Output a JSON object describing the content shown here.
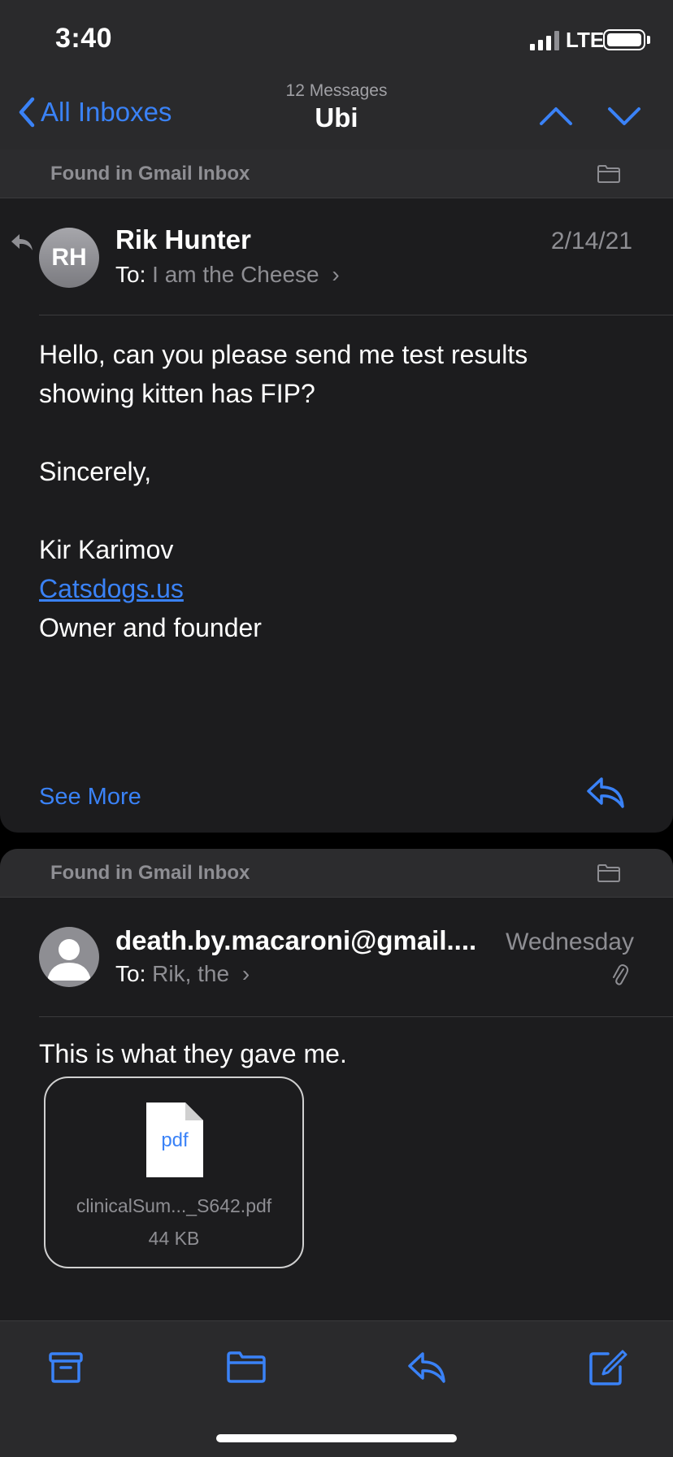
{
  "status_bar": {
    "time": "3:40",
    "network": "LTE"
  },
  "nav": {
    "back_label": "All Inboxes",
    "message_count": "12 Messages",
    "title": "Ubi"
  },
  "messages": [
    {
      "found_in": "Found in Gmail Inbox",
      "avatar_initials": "RH",
      "sender": "Rik Hunter",
      "to_label": "To:",
      "to_names": "I am the Cheese",
      "date": "2/14/21",
      "body": {
        "line1": "Hello, can you please send me test results",
        "line2": "showing kitten has FIP?",
        "closing": "Sincerely,",
        "signature_name": "Kir Karimov",
        "signature_link": "Catsdogs.us",
        "signature_title": "Owner and founder"
      },
      "see_more": "See More"
    },
    {
      "found_in": "Found in Gmail Inbox",
      "sender": "death.by.macaroni@gmail....",
      "to_label": "To:",
      "to_names": "Rik, the",
      "date": "Wednesday",
      "body": "This is what they gave me.",
      "attachment": {
        "type_label": "pdf",
        "filename": "clinicalSum..._S642.pdf",
        "size": "44 KB"
      }
    }
  ],
  "colors": {
    "accent": "#3a82f7",
    "background": "#1c1c1e",
    "secondary_text": "#8e8e93"
  },
  "icons": [
    "back-chevron-icon",
    "chevron-up-icon",
    "chevron-down-icon",
    "folder-icon",
    "reply-icon",
    "paperclip-icon",
    "archive-icon",
    "move-folder-icon",
    "compose-icon"
  ]
}
